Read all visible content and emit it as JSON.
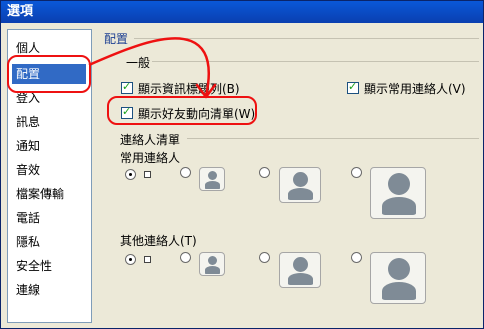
{
  "window": {
    "title": "選項"
  },
  "sidebar": {
    "items": [
      {
        "label": "個人"
      },
      {
        "label": "配置"
      },
      {
        "label": "登入"
      },
      {
        "label": "訊息"
      },
      {
        "label": "通知"
      },
      {
        "label": "音效"
      },
      {
        "label": "檔案傳輸"
      },
      {
        "label": "電話"
      },
      {
        "label": "隱私"
      },
      {
        "label": "安全性"
      },
      {
        "label": "連線"
      }
    ],
    "selected": "配置"
  },
  "layout_section": {
    "title": "配置",
    "general": {
      "heading": "一般",
      "options": [
        {
          "label": "顯示資訊標題列(B)",
          "checked": true
        },
        {
          "label": "顯示常用連絡人(V)",
          "checked": true
        },
        {
          "label": "顯示好友動向清單(W)",
          "checked": true
        }
      ]
    },
    "contact_list": {
      "heading": "連絡人清單",
      "frequent": {
        "label": "常用連絡人"
      },
      "others": {
        "label": "其他連絡人(T)"
      }
    }
  }
}
